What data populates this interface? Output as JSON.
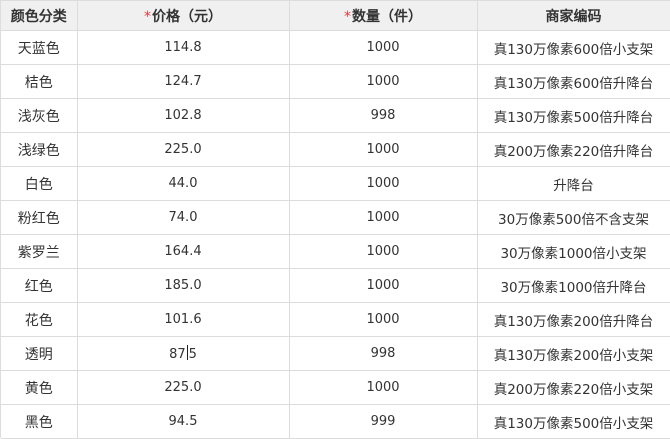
{
  "table": {
    "headers": {
      "color": "颜色分类",
      "price_required": "*",
      "price": "价格（元）",
      "qty_required": "*",
      "qty": "数量（件）",
      "code": "商家编码"
    },
    "rows": [
      {
        "color": "天蓝色",
        "price": "114.8",
        "qty": "1000",
        "code": "真130万像素600倍小支架"
      },
      {
        "color": "桔色",
        "price": "124.7",
        "qty": "1000",
        "code": "真130万像素600倍升降台"
      },
      {
        "color": "浅灰色",
        "price": "102.8",
        "qty": "998",
        "code": "真130万像素500倍升降台"
      },
      {
        "color": "浅绿色",
        "price": "225.0",
        "qty": "1000",
        "code": "真200万像素220倍升降台"
      },
      {
        "color": "白色",
        "price": "44.0",
        "qty": "1000",
        "code": "升降台"
      },
      {
        "color": "粉红色",
        "price": "74.0",
        "qty": "1000",
        "code": "30万像素500倍不含支架"
      },
      {
        "color": "紫罗兰",
        "price": "164.4",
        "qty": "1000",
        "code": "30万像素1000倍小支架"
      },
      {
        "color": "红色",
        "price": "185.0",
        "qty": "1000",
        "code": "30万像素1000倍升降台"
      },
      {
        "color": "花色",
        "price": "101.6",
        "qty": "1000",
        "code": "真130万像素200倍升降台"
      },
      {
        "color": "透明",
        "price_before_caret": "87",
        "price_after_caret": "5",
        "qty": "998",
        "code": "真130万像素200倍小支架"
      },
      {
        "color": "黄色",
        "price": "225.0",
        "qty": "1000",
        "code": "真200万像素220倍小支架"
      },
      {
        "color": "黑色",
        "price": "94.5",
        "qty": "999",
        "code": "真130万像素500倍小支架"
      }
    ]
  }
}
